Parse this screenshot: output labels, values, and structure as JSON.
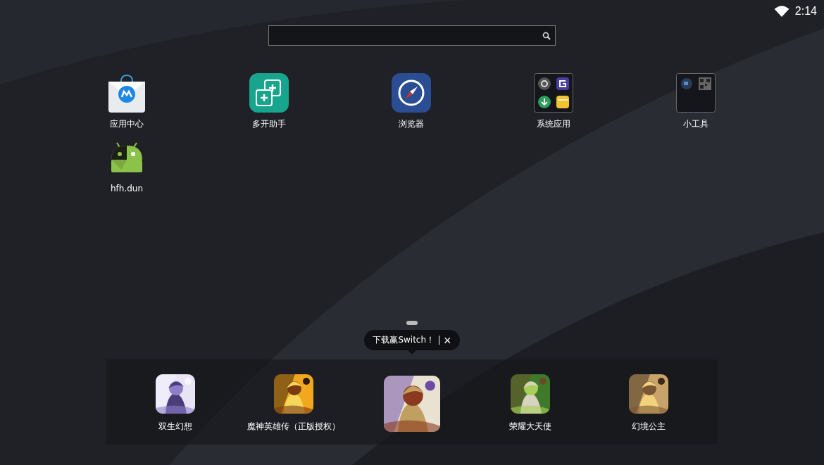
{
  "status_bar": {
    "time": "2:14"
  },
  "desktop": [
    [
      {
        "label": "应用中心",
        "kind": "store"
      },
      {
        "label": "多开助手",
        "kind": "clone"
      },
      {
        "label": "浏览器",
        "kind": "browser"
      },
      {
        "label": "系统应用",
        "kind": "folder-system"
      },
      {
        "label": "小工具",
        "kind": "folder-tools"
      }
    ],
    [
      {
        "label": "hfh.dun",
        "kind": "android"
      }
    ]
  ],
  "tooltip": {
    "text": "下载赢Switch！",
    "close": "×"
  },
  "dock": [
    {
      "label": "双生幻想",
      "selected": false
    },
    {
      "label": "魔神英雄传（正版授权）",
      "selected": false
    },
    {
      "selected": true
    },
    {
      "label": "荣耀大天使",
      "selected": false
    },
    {
      "label": "幻境公主",
      "selected": false
    }
  ]
}
